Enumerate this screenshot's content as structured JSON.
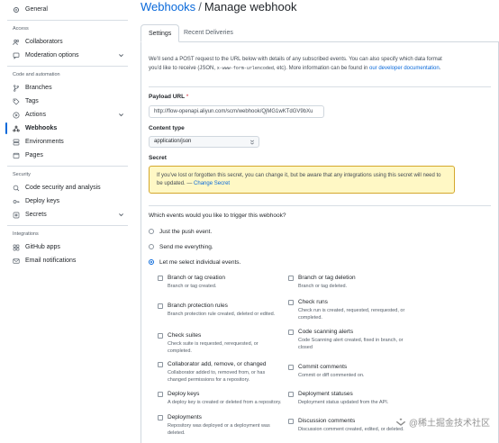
{
  "sidebar": {
    "general": "General",
    "access_heading": "Access",
    "collaborators": "Collaborators",
    "moderation": "Moderation options",
    "code_heading": "Code and automation",
    "branches": "Branches",
    "tags": "Tags",
    "actions": "Actions",
    "webhooks": "Webhooks",
    "environments": "Environments",
    "pages": "Pages",
    "security_heading": "Security",
    "code_security": "Code security and analysis",
    "deploy_keys": "Deploy keys",
    "secrets": "Secrets",
    "integrations_heading": "Integrations",
    "github_apps": "GitHub apps",
    "email_notifications": "Email notifications"
  },
  "header": {
    "crumb": "Webhooks",
    "separator": "/",
    "title": "Manage webhook"
  },
  "tabs": {
    "settings": "Settings",
    "recent": "Recent Deliveries"
  },
  "intro": {
    "part1": "We’ll send a POST request to the URL below with details of any subscribed events. You can also specify which data format you’d like to receive (JSON,",
    "code": "x-www-form-urlencoded",
    "part2": ", etc). More information can be found in",
    "link": "our developer documentation",
    "end": "."
  },
  "payload": {
    "label": "Payload URL",
    "required": "*",
    "value": "http://flow-openapi.aliyun.com/scm/webhook/QjMG1wKTdGV9bXu"
  },
  "content_type": {
    "label": "Content type",
    "value": "application/json"
  },
  "secret": {
    "label": "Secret",
    "warning": "If you’ve lost or forgotten this secret, you can change it, but be aware that any integrations using this secret will need to be updated. —",
    "change_link": "Change Secret"
  },
  "events": {
    "question": "Which events would you like to trigger this webhook?",
    "opt_push": "Just the push event.",
    "opt_all": "Send me everything.",
    "opt_select": "Let me select individual events."
  },
  "event_list": {
    "e1": {
      "name": "Branch or tag creation",
      "desc": "Branch or tag created."
    },
    "e2": {
      "name": "Branch or tag deletion",
      "desc": "Branch or tag deleted."
    },
    "e3": {
      "name": "Branch protection rules",
      "desc": "Branch protection rule created, deleted or edited."
    },
    "e4": {
      "name": "Check runs",
      "desc": "Check run is created, requested, rerequested, or completed."
    },
    "e5": {
      "name": "Check suites",
      "desc": "Check suite is requested, rerequested, or completed."
    },
    "e6": {
      "name": "Code scanning alerts",
      "desc": "Code Scanning alert created, fixed in branch, or closed"
    },
    "e7": {
      "name": "Collaborator add, remove, or changed",
      "desc": "Collaborator added to, removed from, or has changed permissions for a repository."
    },
    "e8": {
      "name": "Commit comments",
      "desc": "Commit or diff commented on."
    },
    "e9": {
      "name": "Deploy keys",
      "desc": "A deploy key is created or deleted from a repository."
    },
    "e10": {
      "name": "Deployment statuses",
      "desc": "Deployment status updated from the API."
    },
    "e11": {
      "name": "Deployments",
      "desc": "Repository was deployed or a deployment was deleted."
    },
    "e12": {
      "name": "Discussion comments",
      "desc": "Discussion comment created, edited, or deleted."
    }
  },
  "watermark": "@稀土掘金技术社区",
  "colors": {
    "accent": "#0969da",
    "warning_bg": "#fff8c5",
    "warning_border": "#d4a72c",
    "required": "#cf222e"
  }
}
